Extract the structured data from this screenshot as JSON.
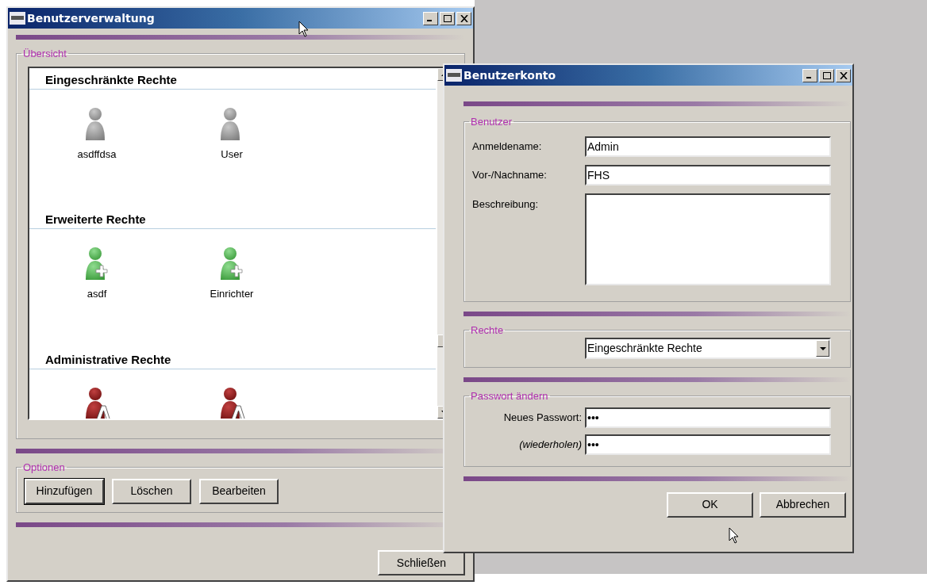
{
  "main_window": {
    "title": "Benutzerverwaltung",
    "overview": {
      "title": "Übersicht",
      "groups": [
        {
          "title": "Eingeschränkte Rechte",
          "users": [
            {
              "kind": "restricted",
              "name": "asdffdsa"
            },
            {
              "kind": "restricted",
              "name": "User"
            }
          ]
        },
        {
          "title": "Erweiterte Rechte",
          "users": [
            {
              "kind": "extended",
              "name": "asdf"
            },
            {
              "kind": "extended",
              "name": "Einrichter"
            }
          ]
        },
        {
          "title": "Administrative Rechte",
          "users": [
            {
              "kind": "admin"
            },
            {
              "kind": "admin"
            }
          ]
        }
      ]
    },
    "options": {
      "title": "Optionen",
      "buttons": [
        {
          "label": "Hinzufügen",
          "focused": true
        },
        {
          "label": "Löschen",
          "focused": false
        },
        {
          "label": "Bearbeiten",
          "focused": false
        }
      ]
    },
    "close_button": "Schließen"
  },
  "dialog": {
    "title": "Benutzerkonto",
    "user_group": {
      "title": "Benutzer",
      "fields": [
        {
          "label": "Anmeldename:",
          "value": "Admin"
        },
        {
          "label": "Vor-/Nachname:",
          "value": "FHS"
        }
      ],
      "description_label": "Beschreibung:"
    },
    "rights_group": {
      "title": "Rechte",
      "value": "Eingeschränkte Rechte"
    },
    "password_group": {
      "title": "Passwort ändern",
      "fields": [
        {
          "label": "Neues Passwort:",
          "value": "•••",
          "italic": false
        },
        {
          "label": "(wiederholen)",
          "value": "•••",
          "italic": true
        }
      ]
    },
    "buttons": [
      "OK",
      "Abbrechen"
    ]
  }
}
